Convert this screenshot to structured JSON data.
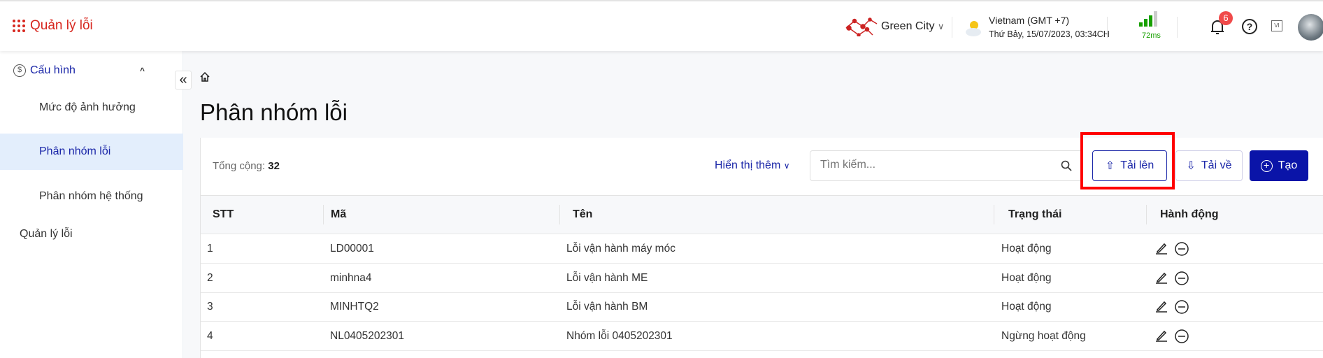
{
  "app": {
    "title": "Quản lý lỗi"
  },
  "header": {
    "org": "Green City",
    "timezone": "Vietnam (GMT +7)",
    "datetime": "Thứ Bảy, 15/07/2023, 03:34CH",
    "latency": "72ms",
    "notifications": "6",
    "language": "VI"
  },
  "sidebar": {
    "group": "Cấu hình",
    "items": [
      {
        "label": "Mức độ ảnh hưởng"
      },
      {
        "label": "Phân nhóm lỗi"
      },
      {
        "label": "Phân nhóm hệ thống"
      }
    ],
    "other": "Quản lý lỗi"
  },
  "page": {
    "title": "Phân nhóm lỗi",
    "total_label": "Tổng cộng:",
    "total": "32",
    "more_label": "Hiển thị thêm",
    "search_placeholder": "Tìm kiếm...",
    "upload": "Tải lên",
    "download": "Tải về",
    "create": "Tạo"
  },
  "table": {
    "headers": [
      "STT",
      "Mã",
      "Tên",
      "Trạng thái",
      "Hành động"
    ],
    "rows": [
      [
        "1",
        "LD00001",
        "Lỗi vận hành máy móc",
        "Hoạt động"
      ],
      [
        "2",
        "minhna4",
        "Lỗi vận hành ME",
        "Hoạt động"
      ],
      [
        "3",
        "MINHTQ2",
        "Lỗi vận hành BM",
        "Hoạt động"
      ],
      [
        "4",
        "NL0405202301",
        "Nhóm lỗi 0405202301",
        "Ngừng hoạt động"
      ]
    ]
  },
  "colors": {
    "brand_red": "#d7261e",
    "primary": "#0a14a8",
    "selected_bg": "#e3eefc"
  }
}
